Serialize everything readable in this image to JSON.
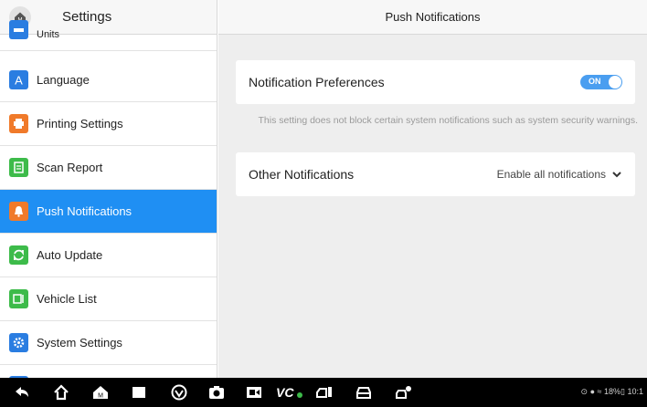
{
  "left_panel": {
    "title": "Settings",
    "home_label": "M",
    "items": [
      {
        "label": "Units",
        "icon": "units-icon",
        "color": "#2a7de1"
      },
      {
        "label": "Language",
        "icon": "language-icon",
        "color": "#2a7de1"
      },
      {
        "label": "Printing Settings",
        "icon": "printer-icon",
        "color": "#f07a2a"
      },
      {
        "label": "Scan Report",
        "icon": "report-icon",
        "color": "#3dbb4a"
      },
      {
        "label": "Push Notifications",
        "icon": "bell-icon",
        "color": "#f07a2a",
        "active": true
      },
      {
        "label": "Auto Update",
        "icon": "refresh-icon",
        "color": "#3dbb4a"
      },
      {
        "label": "Vehicle List",
        "icon": "vehicle-list-icon",
        "color": "#3dbb4a"
      },
      {
        "label": "System Settings",
        "icon": "gear-icon",
        "color": "#2a7de1"
      }
    ]
  },
  "right_panel": {
    "title": "Push Notifications",
    "notification_preferences": {
      "label": "Notification Preferences",
      "toggle_text": "ON",
      "toggle_on": true
    },
    "hint": "This setting does not block certain system notifications such as system security warnings.",
    "other_notifications": {
      "label": "Other Notifications",
      "value": "Enable all notifications"
    }
  },
  "navbar": {
    "status_text": "18%",
    "time_fragment": "10:1",
    "icons": [
      "back-icon",
      "home-icon",
      "autel-home-icon",
      "square-icon",
      "browser-icon",
      "camera-icon",
      "screen-record-icon",
      "vci-icon",
      "vehicle-diagnose-icon",
      "car-icon",
      "car-service-icon"
    ]
  },
  "colors": {
    "accent": "#1f8ff3",
    "toggle": "#4a9ef0",
    "background": "#eeeeee"
  }
}
